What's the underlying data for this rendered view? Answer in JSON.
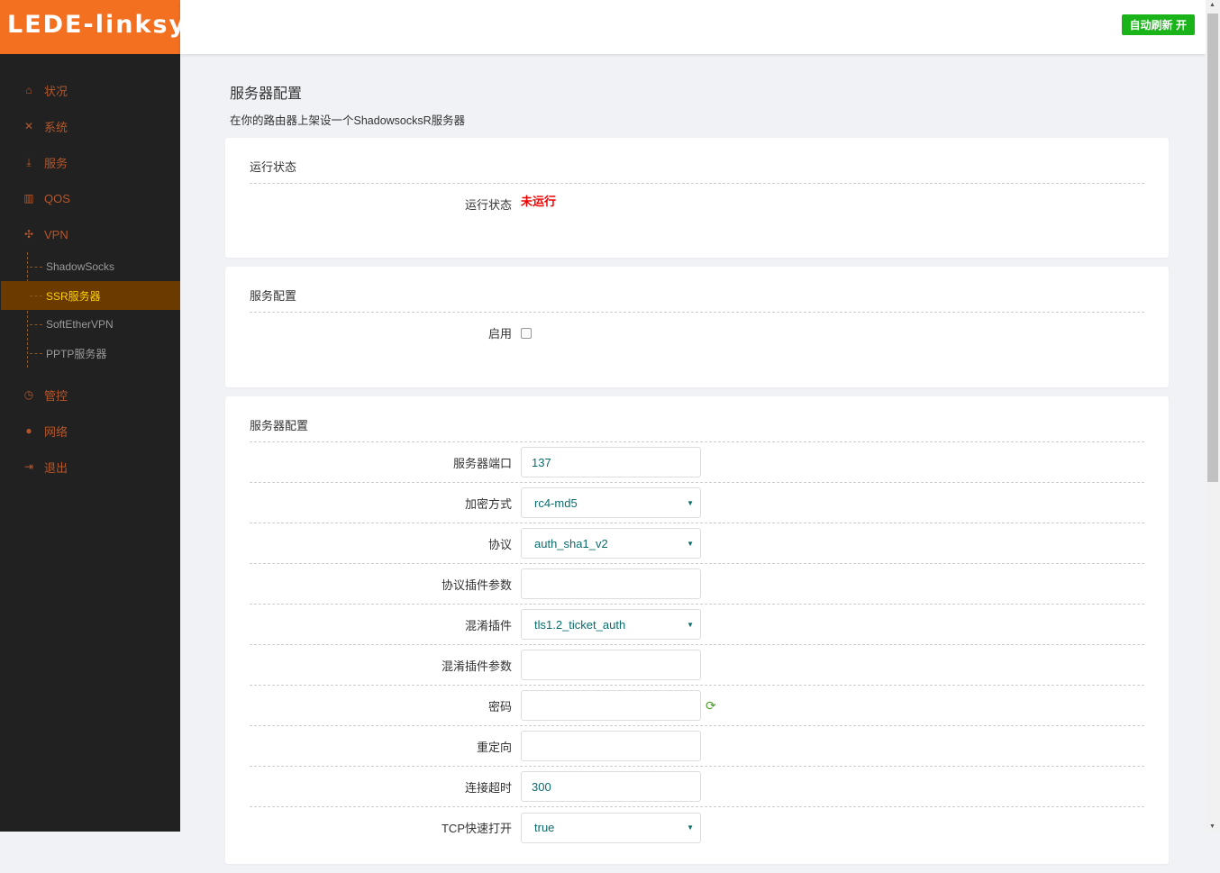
{
  "brand": {
    "name": "LEDE-linksys",
    "mark": "®"
  },
  "topbar": {
    "auto_refresh": "自动刷新 开"
  },
  "nav": [
    {
      "label": "状况",
      "icon": "⌂"
    },
    {
      "label": "系统",
      "icon": "✕"
    },
    {
      "label": "服务",
      "icon": "⤓"
    },
    {
      "label": "QOS",
      "icon": "▥"
    },
    {
      "label": "VPN",
      "icon": "✣"
    }
  ],
  "vpn_sub": [
    "ShadowSocks",
    "SSR服务器",
    "SoftEtherVPN",
    "PPTP服务器"
  ],
  "nav2": [
    {
      "label": "管控",
      "icon": "◷"
    },
    {
      "label": "网络",
      "icon": "●"
    },
    {
      "label": "退出",
      "icon": "⇥"
    }
  ],
  "page": {
    "title": "服务器配置",
    "desc": "在你的路由器上架设一个ShadowsocksR服务器"
  },
  "status_card": {
    "title": "运行状态",
    "label": "运行状态",
    "value": "未运行"
  },
  "service_card": {
    "title": "服务配置",
    "enable_label": "启用"
  },
  "server_card": {
    "title": "服务器配置",
    "rows": [
      {
        "label": "服务器端口",
        "value": "137",
        "type": "text"
      },
      {
        "label": "加密方式",
        "value": "rc4-md5",
        "type": "select"
      },
      {
        "label": "协议",
        "value": "auth_sha1_v2",
        "type": "select"
      },
      {
        "label": "协议插件参数",
        "value": "",
        "type": "text"
      },
      {
        "label": "混淆插件",
        "value": "tls1.2_ticket_auth",
        "type": "select"
      },
      {
        "label": "混淆插件参数",
        "value": "",
        "type": "text"
      },
      {
        "label": "密码",
        "value": "",
        "type": "password"
      },
      {
        "label": "重定向",
        "value": "",
        "type": "text"
      },
      {
        "label": "连接超时",
        "value": "300",
        "type": "text"
      },
      {
        "label": "TCP快速打开",
        "value": "true",
        "type": "select"
      }
    ]
  }
}
